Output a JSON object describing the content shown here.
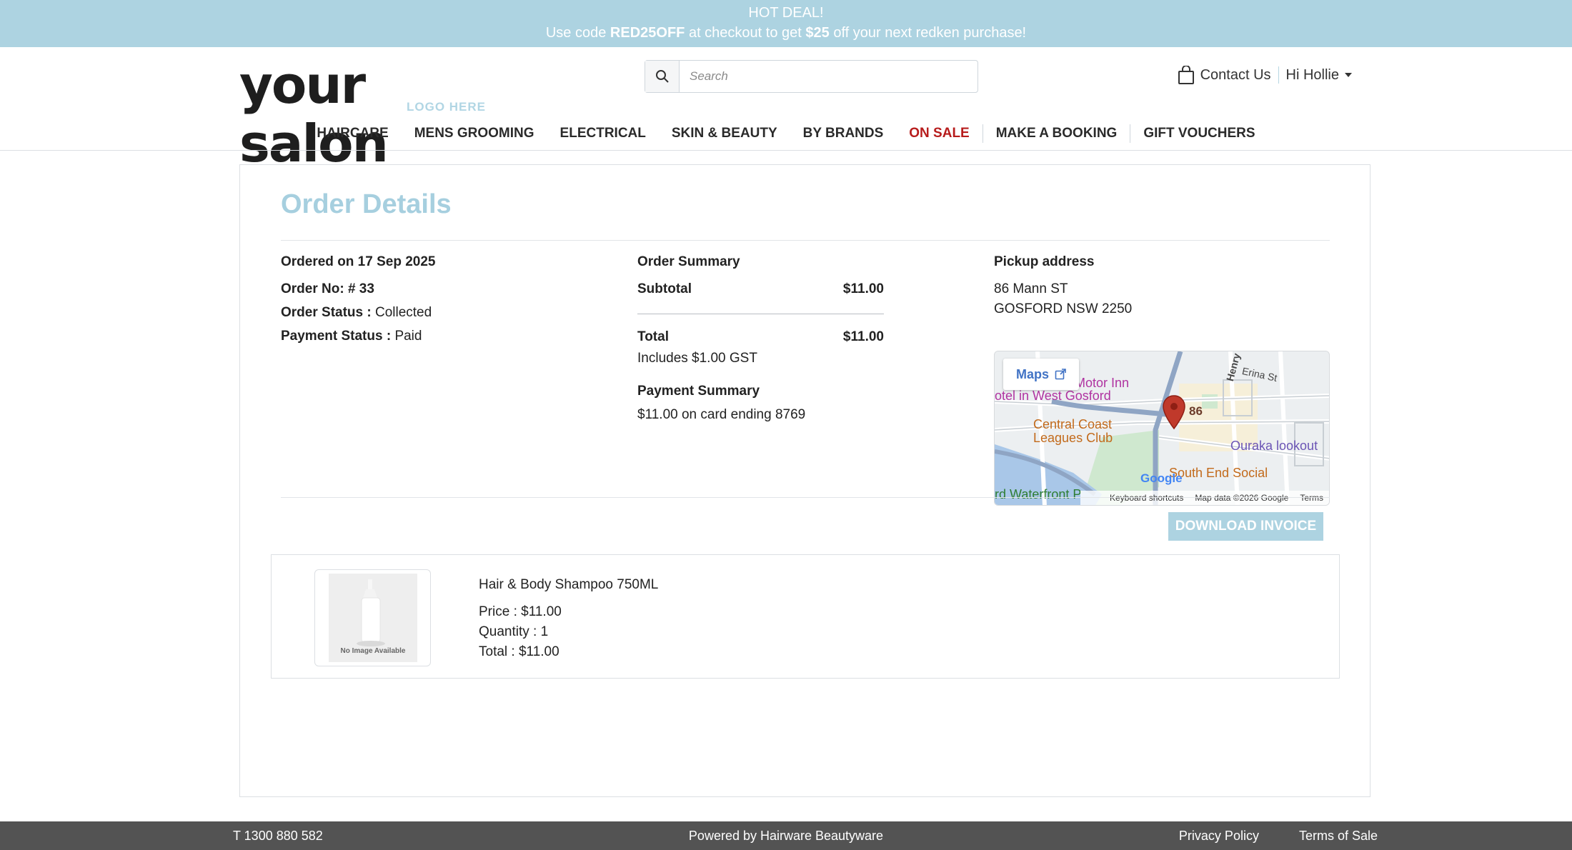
{
  "promo": {
    "line1": "HOT DEAL!",
    "line2_pre": "Use code ",
    "code": "RED25OFF",
    "line2_mid": " at checkout to get ",
    "amount": "$25",
    "line2_post": " off your next redken purchase!",
    "bg_color": "#add3e1"
  },
  "logo": {
    "word": "your salon",
    "sub": "LOGO HERE"
  },
  "search": {
    "placeholder": "Search",
    "value": ""
  },
  "header": {
    "contact": "Contact Us",
    "user": "Hi Hollie"
  },
  "nav": {
    "items": [
      "HAIRCARE",
      "MENS GROOMING",
      "ELECTRICAL",
      "SKIN & BEAUTY",
      "BY BRANDS",
      "ON SALE",
      "MAKE A BOOKING",
      "GIFT VOUCHERS"
    ],
    "sale_color": "#b71c1c"
  },
  "order": {
    "title": "Order Details",
    "ordered_on": "Ordered on 17 Sep 2025",
    "order_no": "Order No: # 33",
    "status_label": "Order Status :",
    "status": "Collected",
    "payment_label": "Payment Status :",
    "payment": "Paid"
  },
  "summary": {
    "heading": "Order Summary",
    "subtotal_label": "Subtotal",
    "subtotal": "$11.00",
    "total_label": "Total",
    "total": "$11.00",
    "gst": "Includes $1.00 GST",
    "payment_heading": "Payment Summary",
    "payment_text": "$11.00 on card ending 8769"
  },
  "pickup": {
    "heading": "Pickup address",
    "line1": "86 Mann ST",
    "line2": "GOSFORD NSW 2250"
  },
  "map": {
    "maps_button": "Maps",
    "pin_label": "86",
    "labels": [
      "Erina St",
      "Henry",
      "otel in West Gosford",
      "Motor Inn",
      "Central Coast",
      "Leagues Club",
      "Ouraka lookout",
      "South End Social",
      "rd Waterfront P"
    ],
    "google": "Google",
    "footer": [
      "Keyboard shortcuts",
      "Map data ©2026 Google",
      "Terms"
    ]
  },
  "actions": {
    "download": "DOWNLOAD INVOICE"
  },
  "item": {
    "name": "Hair & Body Shampoo 750ML",
    "price": "Price : $11.00",
    "quantity": "Quantity : 1",
    "total": "Total : $11.00",
    "no_image": "No Image Available"
  },
  "footer": {
    "phone": "T 1300 880 582",
    "powered": "Powered by Hairware Beautyware",
    "privacy": "Privacy Policy",
    "terms": "Terms of Sale"
  }
}
